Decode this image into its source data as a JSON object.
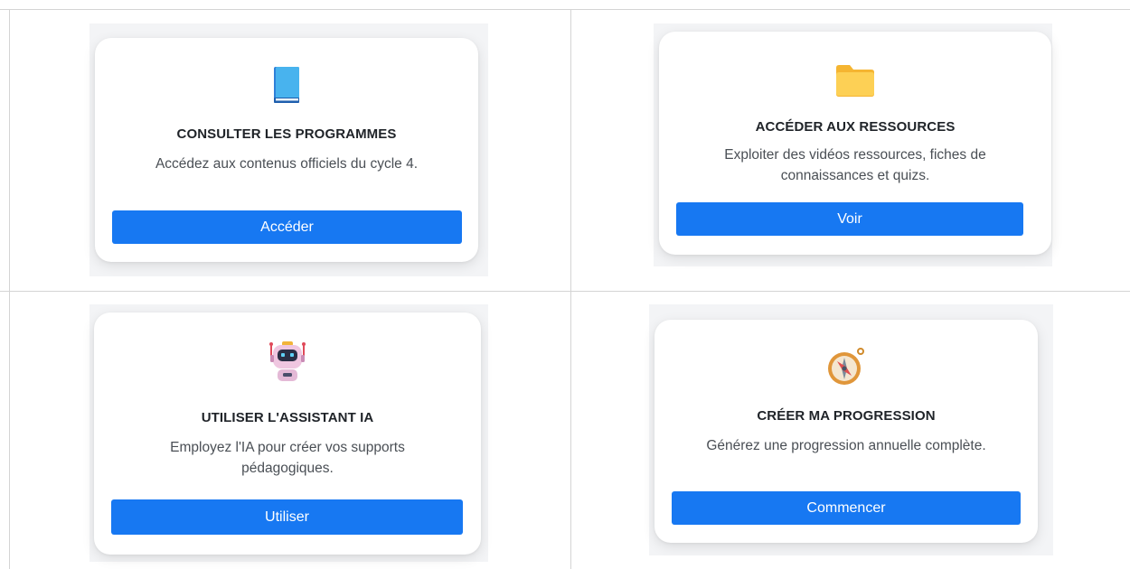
{
  "cards": [
    {
      "icon": "book-icon",
      "title": "CONSULTER LES PROGRAMMES",
      "description": "Accédez aux contenus officiels du cycle 4.",
      "button_label": "Accéder"
    },
    {
      "icon": "folder-icon",
      "title": "ACCÉDER AUX RESSOURCES",
      "description": "Exploiter des vidéos ressources, fiches de connaissances et quizs.",
      "button_label": "Voir"
    },
    {
      "icon": "robot-icon",
      "title": "UTILISER L'ASSISTANT IA",
      "description": "Employez l'IA pour créer vos supports pédagogiques.",
      "button_label": "Utiliser"
    },
    {
      "icon": "compass-icon",
      "title": "CRÉER MA PROGRESSION",
      "description": "Générez une progression annuelle complète.",
      "button_label": "Commencer"
    }
  ],
  "colors": {
    "button": "#1778f2",
    "title": "#1f2328",
    "text": "#4a4f55",
    "border": "#d4d4d4"
  }
}
